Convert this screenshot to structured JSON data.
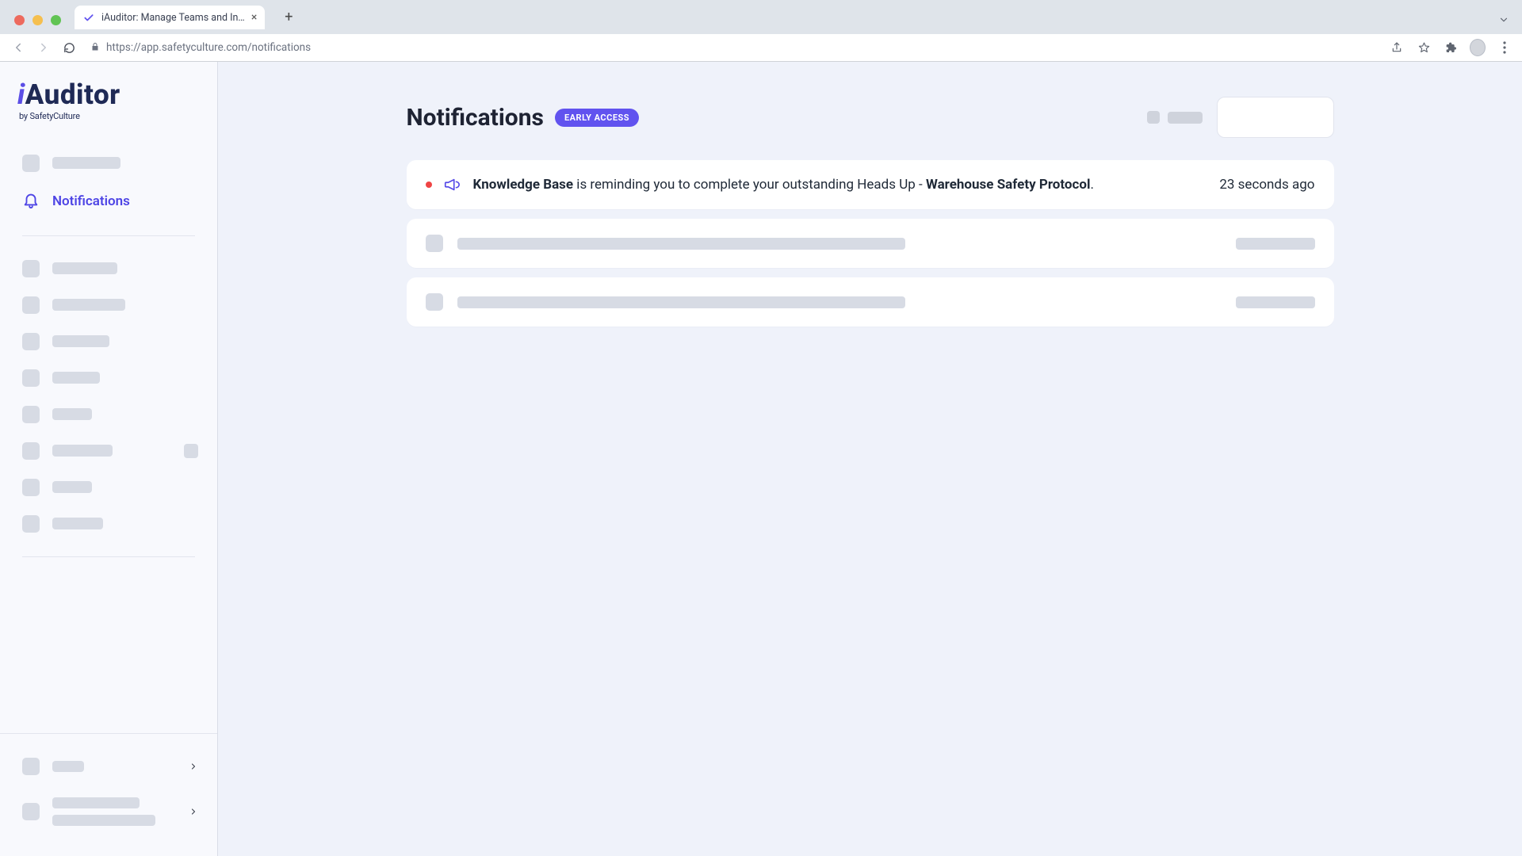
{
  "browser": {
    "tab_title": "iAuditor: Manage Teams and In…",
    "url_display": "https://app.safetyculture.com/notifications"
  },
  "logo": {
    "prefix": "i",
    "main": "Auditor",
    "sub": "by SafetyCulture"
  },
  "sidebar": {
    "active_label": "Notifications"
  },
  "header": {
    "title": "Notifications",
    "badge": "EARLY ACCESS"
  },
  "notification": {
    "source": "Knowledge Base",
    "middle": " is reminding you to complete your outstanding Heads Up - ",
    "subject": "Warehouse Safety Protocol",
    "suffix": ".",
    "time": "23 seconds ago"
  }
}
